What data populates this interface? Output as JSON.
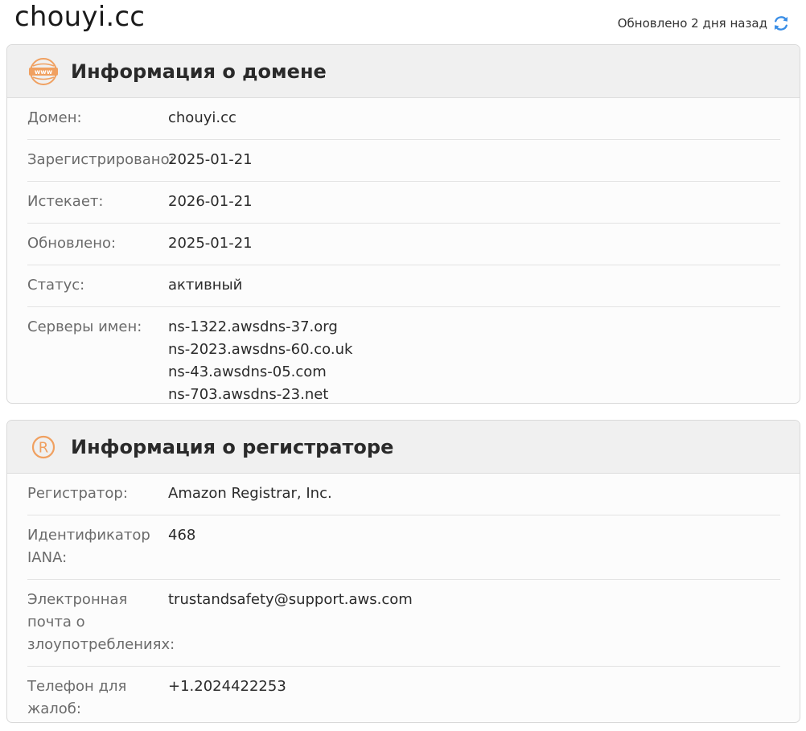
{
  "header": {
    "domain": "chouyi.cc",
    "updated_text": "Обновлено 2 дня назад"
  },
  "domain_info": {
    "title": "Информация о домене",
    "rows": [
      {
        "label": "Домен:",
        "value": "chouyi.cc"
      },
      {
        "label": "Зарегистрировано:",
        "value": "2025-01-21"
      },
      {
        "label": "Истекает:",
        "value": "2026-01-21"
      },
      {
        "label": "Обновлено:",
        "value": "2025-01-21"
      },
      {
        "label": "Статус:",
        "value": "активный"
      }
    ],
    "nameservers_label": "Серверы имен:",
    "nameservers": [
      "ns-1322.awsdns-37.org",
      "ns-2023.awsdns-60.co.uk",
      "ns-43.awsdns-05.com",
      "ns-703.awsdns-23.net"
    ]
  },
  "registrar_info": {
    "title": "Информация о регистраторе",
    "rows": [
      {
        "label": "Регистратор:",
        "value": "Amazon Registrar, Inc."
      },
      {
        "label": "Идентификатор IANA:",
        "value": "468"
      },
      {
        "label": "Электронная почта о злоупотреблениях:",
        "value": "trustandsafety@support.aws.com"
      },
      {
        "label": "Телефон для жалоб:",
        "value": "+1.2024422253"
      }
    ]
  },
  "icons": {
    "refresh": "refresh-icon",
    "www": "www-icon",
    "registered": "registered-icon"
  },
  "colors": {
    "accent_orange": "#f0a060",
    "refresh_blue": "#3a8ee6"
  }
}
